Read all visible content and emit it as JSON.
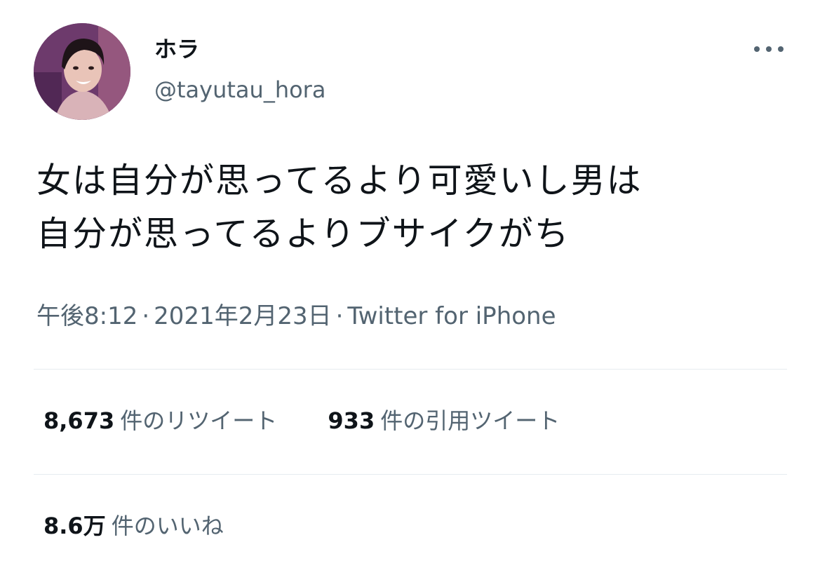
{
  "author": {
    "display_name": "ホラ",
    "handle": "@tayutau_hora"
  },
  "tweet": {
    "text_lines": [
      "女は自分が思ってるより可愛いし男は",
      "自分が思ってるよりブサイクがち"
    ],
    "time": "午後8:12",
    "date": "2021年2月23日",
    "source": "Twitter for iPhone",
    "separator": "·"
  },
  "stats": {
    "retweets_count": "8,673",
    "retweets_label": "件のリツイート",
    "quotes_count": "933",
    "quotes_label": "件の引用ツイート",
    "likes_count": "8.6万",
    "likes_label": "件のいいね"
  },
  "icons": {
    "more": "more-options-icon",
    "avatar": "profile-photo"
  },
  "colors": {
    "primary_text": "#0f1419",
    "secondary_text": "#536471",
    "divider": "#e6ecf0"
  }
}
